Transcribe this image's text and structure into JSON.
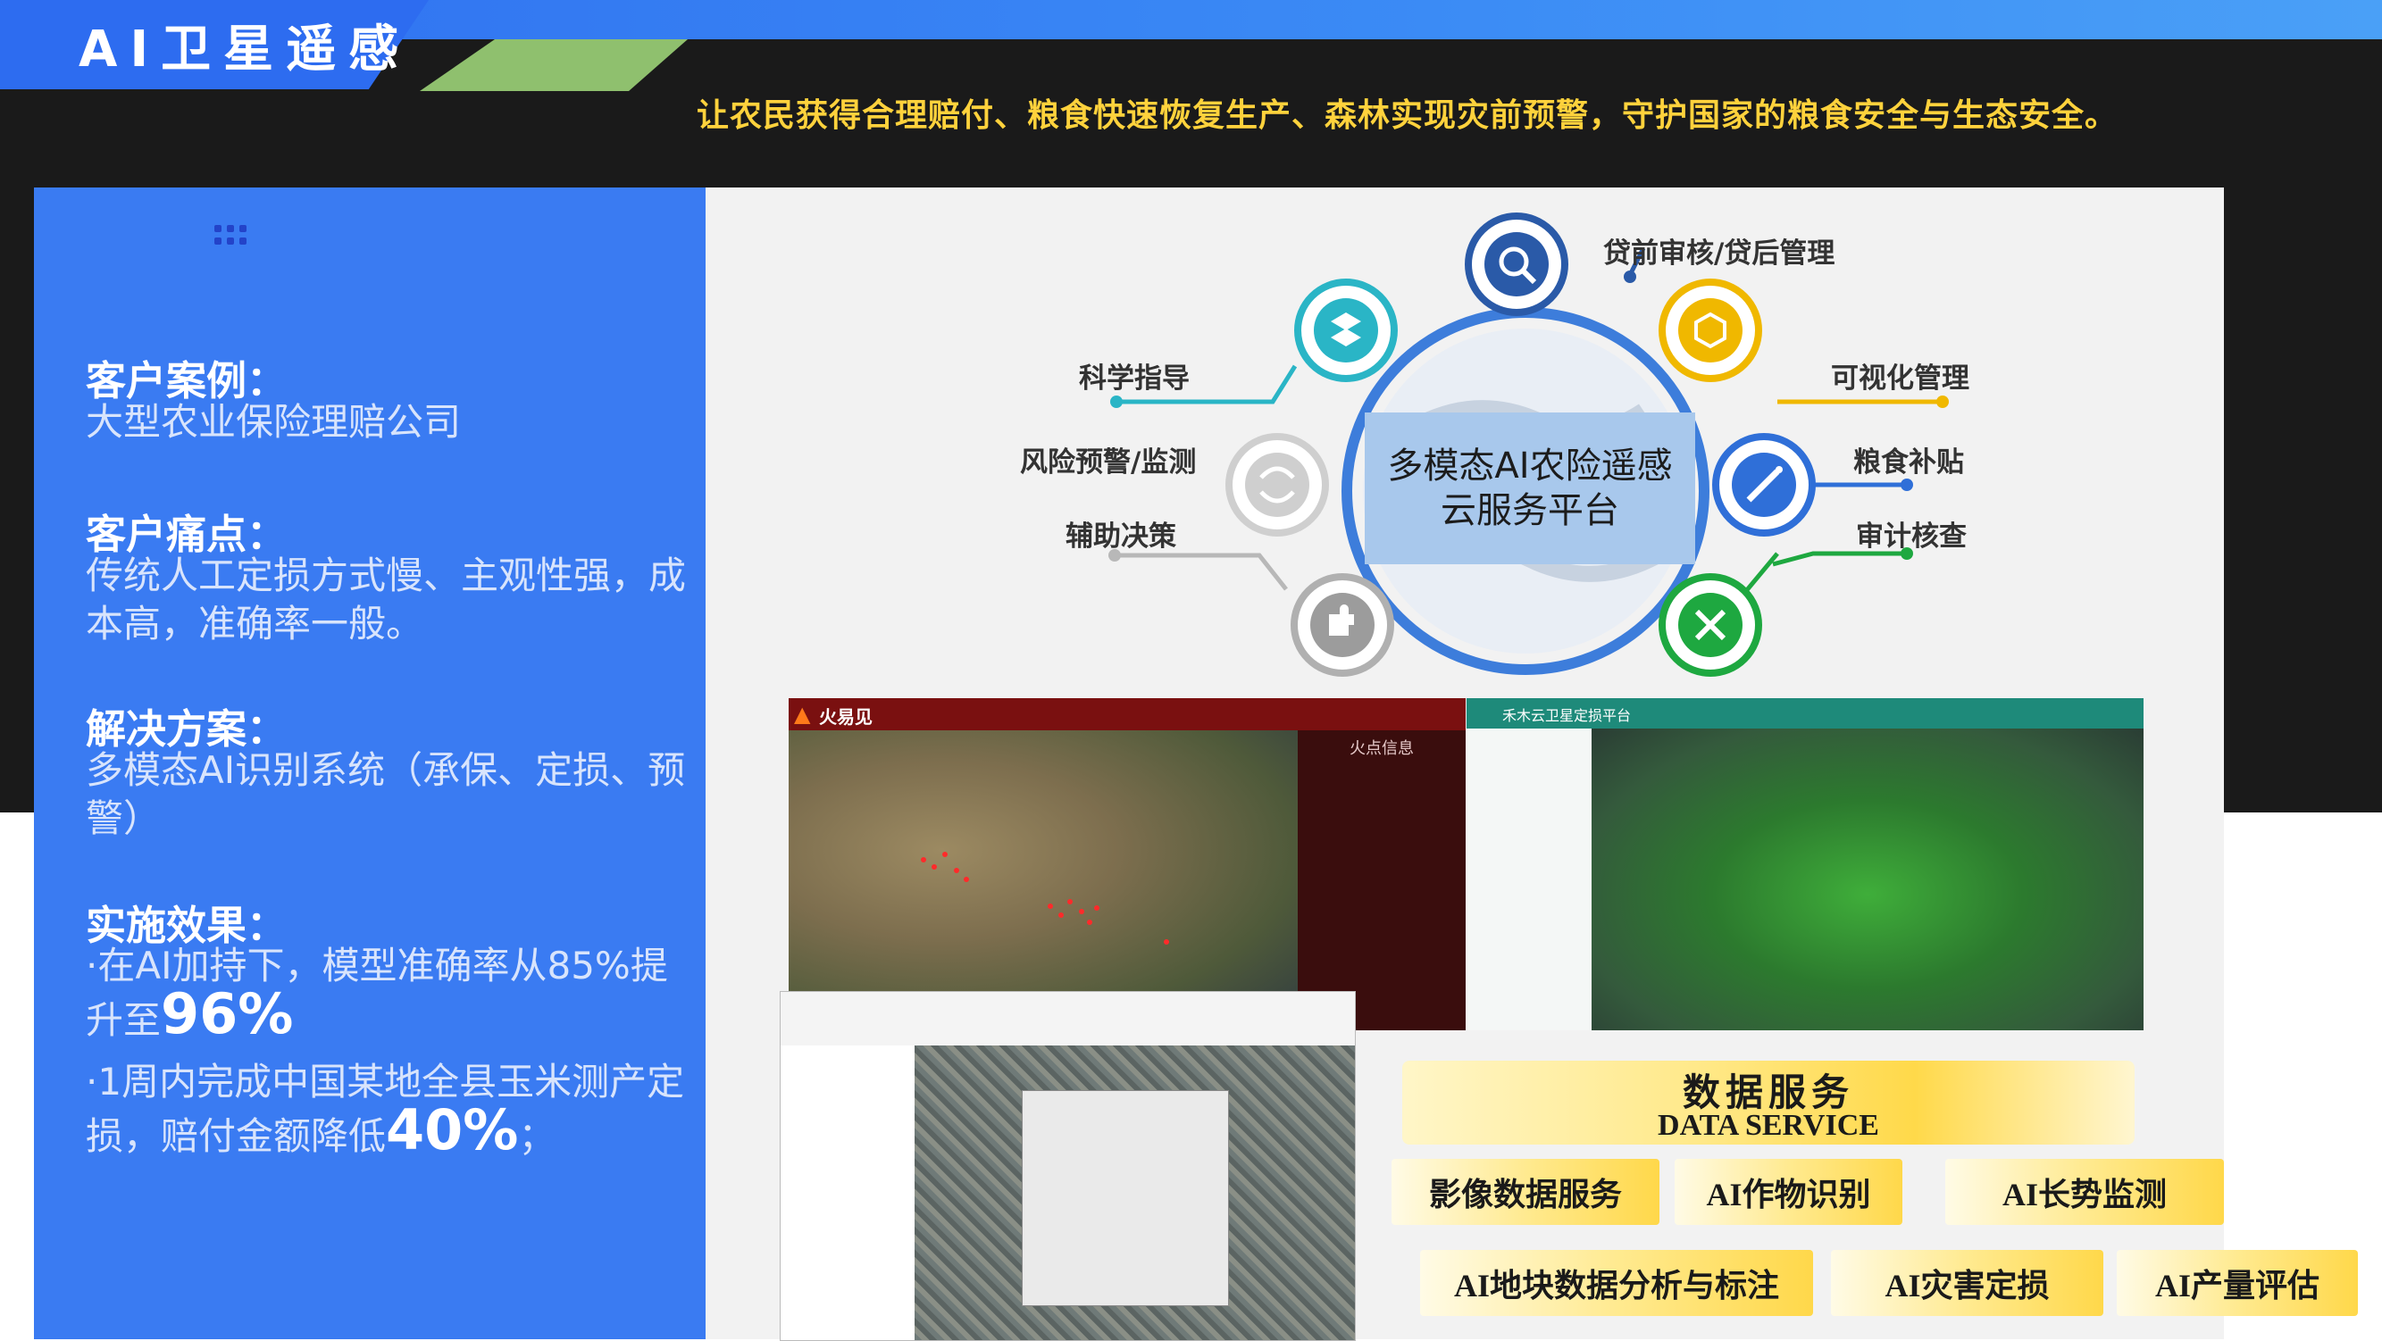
{
  "header": {
    "title": "AI卫星遥感",
    "tagline": "让农民获得合理赔付、粮食快速恢复生产、森林实现灾前预警，守护国家的粮食安全与生态安全。"
  },
  "left_panel": {
    "case_heading": "客户案例：",
    "case_text": "大型农业保险理赔公司",
    "pain_heading": "客户痛点：",
    "pain_text": "传统人工定损方式慢、主观性强，成本高，准确率一般。",
    "solution_heading": "解决方案：",
    "solution_text": "多模态AI识别系统（承保、定损、预警）",
    "effect_heading": "实施效果：",
    "effect_1_pre": "·在AI加持下，模型准确率从85%提升至",
    "effect_1_value": "96%",
    "effect_2_pre": "·1周内完成中国某地全县玉米测产定损，赔付金额降低",
    "effect_2_value": "40%",
    "effect_2_post": "；"
  },
  "diagram": {
    "center": "多模态AI农险遥感云服务平台",
    "nodes": {
      "loan": "贷前审核/贷后管理",
      "science": "科学指导",
      "visual": "可视化管理",
      "risk": "风险预警/监测",
      "grain": "粮食补贴",
      "decision": "辅助决策",
      "audit": "审计核查"
    },
    "colors": {
      "teal": "#2ab5c6",
      "navy": "#2a5aa8",
      "gold": "#f0b800",
      "grey": "#b8b8b8",
      "blue": "#2f6fd8",
      "green": "#1ea840",
      "ring": "#3d7ddb"
    }
  },
  "screens": {
    "fire_title": "火易见",
    "fire_panel": "火点信息",
    "agri_title": "禾木云卫星定损平台"
  },
  "data_service": {
    "title": "数据服务",
    "subtitle": "DATA SERVICE",
    "tags": [
      "影像数据服务",
      "AI作物识别",
      "AI长势监测",
      "AI地块数据分析与标注",
      "AI灾害定损",
      "AI产量评估"
    ]
  }
}
